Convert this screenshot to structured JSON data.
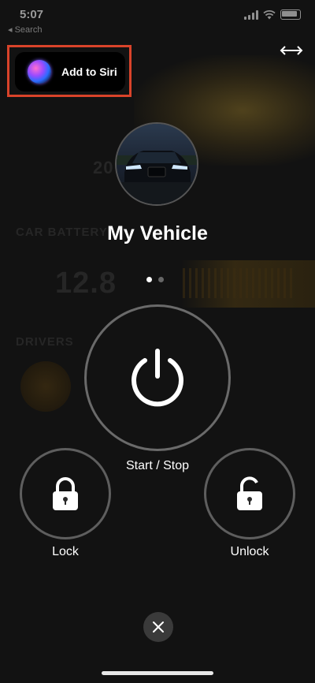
{
  "status_bar": {
    "time": "5:07",
    "back_label": "◂ Search"
  },
  "siri": {
    "label": "Add to Siri"
  },
  "vehicle": {
    "name": "My Vehicle"
  },
  "pager": {
    "pages": 2,
    "current": 1
  },
  "controls": {
    "start_stop_label": "Start / Stop",
    "lock_label": "Lock",
    "unlock_label": "Unlock"
  },
  "background": {
    "battery_heading": "CAR BATTERY",
    "battery_value": "12.8",
    "drivers_heading": "DRIVERS",
    "model_year": "20"
  },
  "icons": {
    "expand": "expand-arrows-icon",
    "power": "power-icon",
    "lock": "padlock-closed-icon",
    "unlock": "padlock-open-icon",
    "close": "close-x-icon",
    "siri": "siri-orb-icon"
  },
  "colors": {
    "highlight_box": "#d9432a",
    "background": "#121212",
    "ring": "#6a6a6a"
  }
}
